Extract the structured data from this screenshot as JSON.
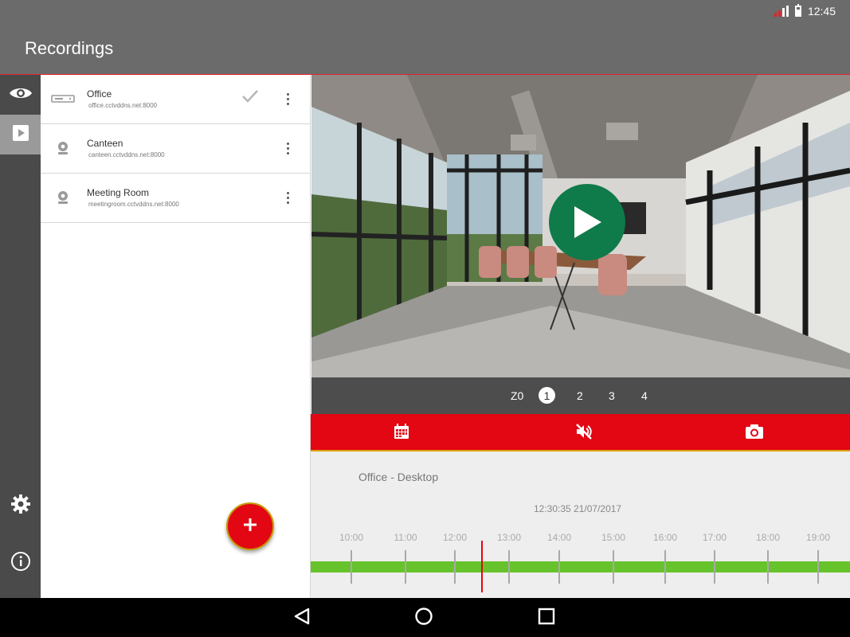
{
  "status_bar": {
    "time": "12:45"
  },
  "header": {
    "title": "Recordings"
  },
  "rail": {
    "icons": [
      "eye-icon",
      "play-icon",
      "gear-icon",
      "info-icon"
    ],
    "active": "play-icon"
  },
  "devices": [
    {
      "name": "Office",
      "address": "office.cctvddns.net:8000",
      "selected": true,
      "icon": "dvr-icon"
    },
    {
      "name": "Canteen",
      "address": "canteen.cctvddns.net:8000",
      "selected": false,
      "icon": "camera-icon"
    },
    {
      "name": "Meeting Room",
      "address": "meetingroom.cctvddns.net:8000",
      "selected": false,
      "icon": "camera-icon"
    }
  ],
  "fab": {
    "label": "+"
  },
  "channels": {
    "zone_label": "Z0",
    "items": [
      "1",
      "2",
      "3",
      "4"
    ],
    "selected": "1"
  },
  "toolbar": {
    "icons": [
      "calendar-icon",
      "mute-icon",
      "camera-snapshot-icon"
    ]
  },
  "timeline": {
    "camera_label": "Office - Desktop",
    "timestamp": "12:30:35  21/07/2017",
    "hours": [
      "10:00",
      "11:00",
      "12:00",
      "13:00",
      "14:00",
      "15:00",
      "16:00",
      "17:00",
      "18:00",
      "19:00"
    ],
    "current_time": "12:30:35"
  },
  "colors": {
    "accent": "#e30613",
    "header": "#6b6b6b",
    "rail": "#4a4a4a",
    "play": "#0f7a4a",
    "recording_bar": "#66c32b"
  }
}
